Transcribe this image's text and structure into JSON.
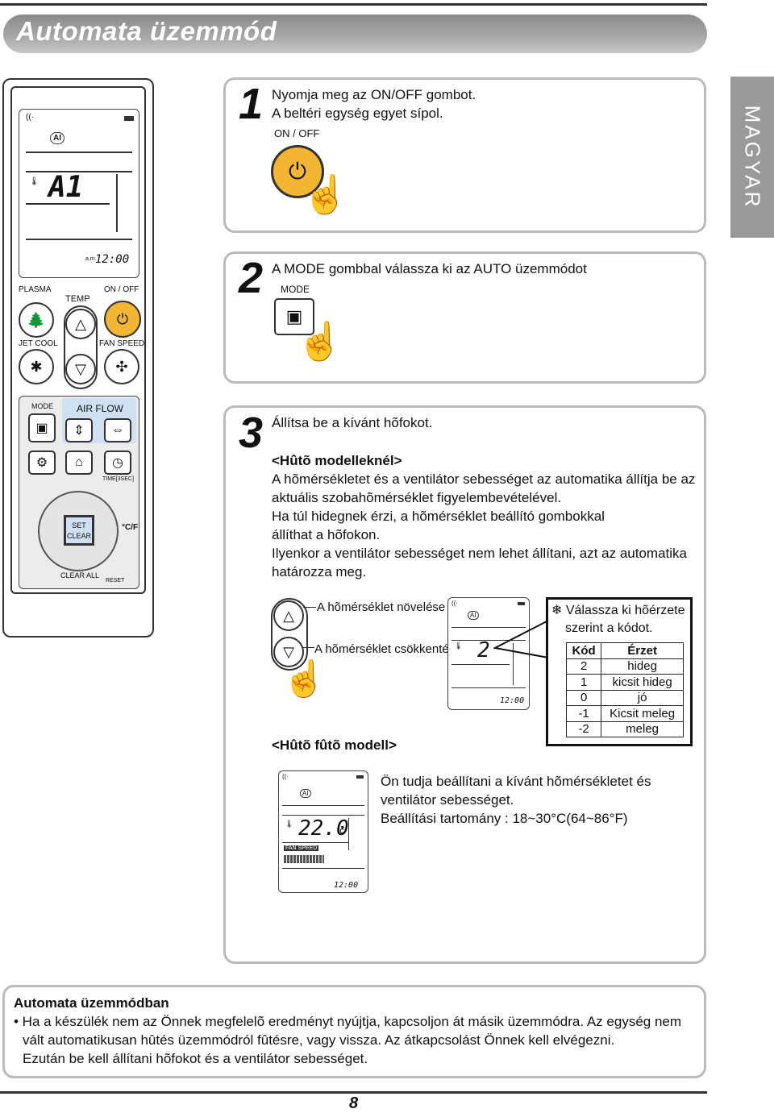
{
  "page": {
    "title": "Automata üzemmód",
    "language_tab": "MAGYAR",
    "page_number": "8"
  },
  "remote": {
    "display_code": "A1",
    "clock": "12:00",
    "clock_prefix": "a.m.",
    "plasma": "PLASMA",
    "temp": "TEMP",
    "on_off": "ON / OFF",
    "jet_cool": "JET COOL",
    "fan_speed": "FAN SPEED",
    "mode": "MODE",
    "air_flow": "AIR FLOW",
    "time": "TIME[3SEC]",
    "set": "SET",
    "clear": "CLEAR",
    "clear_all": "CLEAR ALL",
    "reset": "RESET",
    "unit": "°C/F",
    "ai": "AI"
  },
  "step1": {
    "number": "1",
    "lines": [
      "Nyomja meg az ON/OFF gombot.",
      "A beltéri egység egyet sípol."
    ],
    "button_label": "ON / OFF"
  },
  "step2": {
    "number": "2",
    "text": "A MODE gombbal válassza ki az AUTO üzemmódot",
    "button_label": "MODE"
  },
  "step3": {
    "number": "3",
    "intro": "Állítsa be a kívánt hõfokot.",
    "cool_heading": "<Hûtõ modelleknél>",
    "cool_lines": [
      "A hõmérsékletet és a ventilátor sebességet az automatika állítja be az",
      "aktuális szobahõmérséklet figyelembevételével.",
      "Ha túl hidegnek érzi, a hõmérséklet beállító gombokkal",
      "állíthat a hõfokon.",
      "Ilyenkor a ventilátor sebességet nem lehet állítani, azt az automatika",
      "határozza meg."
    ],
    "increase_label": "A hõmérséklet növelése",
    "decrease_label": "A hõmérséklet csökkentése",
    "display_code": "2",
    "clock": "12:00",
    "note_lines": [
      "Válassza ki hõérzete",
      "szerint a kódot."
    ],
    "table": {
      "headers": [
        "Kód",
        "Érzet"
      ],
      "rows": [
        [
          "2",
          "hideg"
        ],
        [
          "1",
          "kicsit  hideg"
        ],
        [
          "0",
          "jó"
        ],
        [
          "-1",
          "Kicsit  meleg"
        ],
        [
          "-2",
          "meleg"
        ]
      ]
    },
    "heat_heading": "<Hûtõ fûtõ modell>",
    "heat_display": {
      "temp": "22.0",
      "unit": "°C",
      "fan_label": "FAN SPEED",
      "clock": "12:00"
    },
    "heat_lines": [
      "Ön tudja beállítani a kívánt hõmérsékletet és",
      "ventilátor sebességet.",
      "Beállítási tartomány : 18~30°C(64~86°F)"
    ]
  },
  "note": {
    "heading": "Automata üzemmódban",
    "lines": [
      "• Ha a készülék nem az Önnek megfelelõ eredményt nyújtja, kapcsoljon át másik üzemmódra. Az egység nem",
      "vált automatikusan hûtés üzemmódról fûtésre, vagy vissza. Az átkapcsolást Önnek kell elvégezni.",
      "Ezután be kell állítani hõfokot és a ventilátor sebességet."
    ]
  },
  "colors": {
    "accent_yellow": "#f2b632",
    "title_gray": "#9a9a9a",
    "airflow_blue": "#cfe0f3"
  }
}
